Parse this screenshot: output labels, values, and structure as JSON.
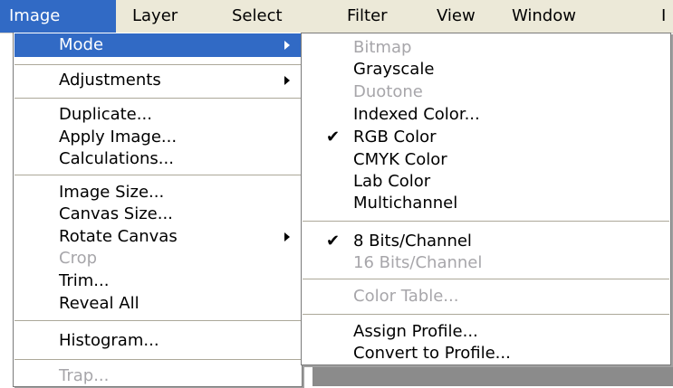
{
  "menubar": {
    "items": [
      {
        "label": "Image"
      },
      {
        "label": "Layer"
      },
      {
        "label": "Select"
      },
      {
        "label": "Filter"
      },
      {
        "label": "View"
      },
      {
        "label": "Window"
      },
      {
        "label": "I"
      }
    ]
  },
  "image_menu": {
    "items": [
      {
        "label": "Mode"
      },
      {
        "label": "Adjustments"
      },
      {
        "label": "Duplicate..."
      },
      {
        "label": "Apply Image..."
      },
      {
        "label": "Calculations..."
      },
      {
        "label": "Image Size..."
      },
      {
        "label": "Canvas Size..."
      },
      {
        "label": "Rotate Canvas"
      },
      {
        "label": "Crop"
      },
      {
        "label": "Trim..."
      },
      {
        "label": "Reveal All"
      },
      {
        "label": "Histogram..."
      },
      {
        "label": "Trap..."
      }
    ]
  },
  "mode_submenu": {
    "items": [
      {
        "label": "Bitmap"
      },
      {
        "label": "Grayscale"
      },
      {
        "label": "Duotone"
      },
      {
        "label": "Indexed Color..."
      },
      {
        "label": "RGB Color"
      },
      {
        "label": "CMYK Color"
      },
      {
        "label": "Lab Color"
      },
      {
        "label": "Multichannel"
      },
      {
        "label": "8 Bits/Channel"
      },
      {
        "label": "16 Bits/Channel"
      },
      {
        "label": "Color Table..."
      },
      {
        "label": "Assign Profile..."
      },
      {
        "label": "Convert to Profile..."
      }
    ],
    "check_glyph": "✔"
  },
  "colors": {
    "highlight": "#316ac5",
    "disabled_text": "#a7a6aa",
    "menubar_bg": "#ece9d8"
  },
  "icons": {
    "submenu_arrow": "triangle-right",
    "checkmark": "check"
  }
}
